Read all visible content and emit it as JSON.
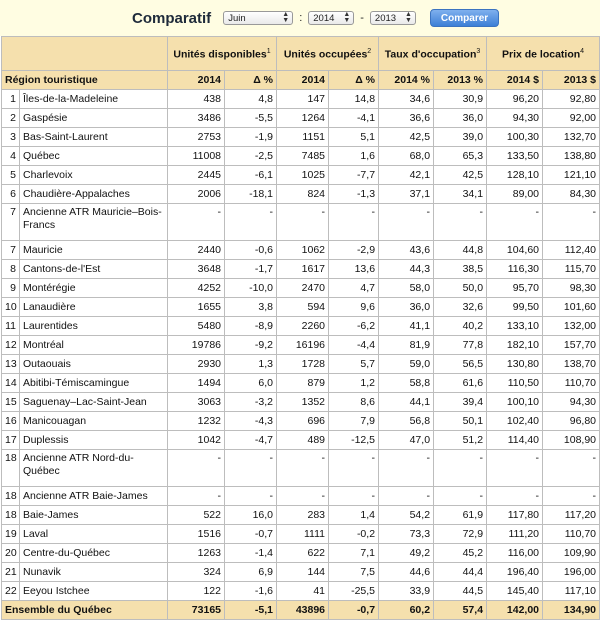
{
  "toolbar": {
    "title": "Comparatif",
    "month": "Juin",
    "year_from": "2014",
    "colon": ":",
    "dash": "-",
    "year_to": "2013",
    "compare_label": "Comparer"
  },
  "groups": [
    {
      "label": "Unités disponibles",
      "note": "1"
    },
    {
      "label": "Unités occupées",
      "note": "2"
    },
    {
      "label": "Taux d'occupation",
      "note": "3"
    },
    {
      "label": "Prix de location",
      "note": "4"
    }
  ],
  "subheaders": [
    "Région touristique",
    "2014",
    "Δ %",
    "2014",
    "Δ %",
    "2014 %",
    "2013 %",
    "2014 $",
    "2013 $"
  ],
  "rows": [
    {
      "n": "1",
      "region": "Îles-de-la-Madeleine",
      "u14": "438",
      "ud": "4,8",
      "o14": "147",
      "od": "14,8",
      "t14": "34,6",
      "t13": "30,9",
      "p14": "96,20",
      "p13": "92,80"
    },
    {
      "n": "2",
      "region": "Gaspésie",
      "u14": "3486",
      "ud": "-5,5",
      "o14": "1264",
      "od": "-4,1",
      "t14": "36,6",
      "t13": "36,0",
      "p14": "94,30",
      "p13": "92,00"
    },
    {
      "n": "3",
      "region": "Bas-Saint-Laurent",
      "u14": "2753",
      "ud": "-1,9",
      "o14": "1151",
      "od": "5,1",
      "t14": "42,5",
      "t13": "39,0",
      "p14": "100,30",
      "p13": "132,70"
    },
    {
      "n": "4",
      "region": "Québec",
      "u14": "11008",
      "ud": "-2,5",
      "o14": "7485",
      "od": "1,6",
      "t14": "68,0",
      "t13": "65,3",
      "p14": "133,50",
      "p13": "138,80"
    },
    {
      "n": "5",
      "region": "Charlevoix",
      "u14": "2445",
      "ud": "-6,1",
      "o14": "1025",
      "od": "-7,7",
      "t14": "42,1",
      "t13": "42,5",
      "p14": "128,10",
      "p13": "121,10"
    },
    {
      "n": "6",
      "region": "Chaudière-Appalaches",
      "u14": "2006",
      "ud": "-18,1",
      "o14": "824",
      "od": "-1,3",
      "t14": "37,1",
      "t13": "34,1",
      "p14": "89,00",
      "p13": "84,30"
    },
    {
      "n": "7",
      "region": "Ancienne ATR Mauricie–Bois-Francs",
      "u14": "-",
      "ud": "-",
      "o14": "-",
      "od": "-",
      "t14": "-",
      "t13": "-",
      "p14": "-",
      "p13": "-",
      "tall": true
    },
    {
      "n": "7",
      "region": "Mauricie",
      "u14": "2440",
      "ud": "-0,6",
      "o14": "1062",
      "od": "-2,9",
      "t14": "43,6",
      "t13": "44,8",
      "p14": "104,60",
      "p13": "112,40"
    },
    {
      "n": "8",
      "region": "Cantons-de-l'Est",
      "u14": "3648",
      "ud": "-1,7",
      "o14": "1617",
      "od": "13,6",
      "t14": "44,3",
      "t13": "38,5",
      "p14": "116,30",
      "p13": "115,70"
    },
    {
      "n": "9",
      "region": "Montérégie",
      "u14": "4252",
      "ud": "-10,0",
      "o14": "2470",
      "od": "4,7",
      "t14": "58,0",
      "t13": "50,0",
      "p14": "95,70",
      "p13": "98,30"
    },
    {
      "n": "10",
      "region": "Lanaudière",
      "u14": "1655",
      "ud": "3,8",
      "o14": "594",
      "od": "9,6",
      "t14": "36,0",
      "t13": "32,6",
      "p14": "99,50",
      "p13": "101,60"
    },
    {
      "n": "11",
      "region": "Laurentides",
      "u14": "5480",
      "ud": "-8,9",
      "o14": "2260",
      "od": "-6,2",
      "t14": "41,1",
      "t13": "40,2",
      "p14": "133,10",
      "p13": "132,00"
    },
    {
      "n": "12",
      "region": "Montréal",
      "u14": "19786",
      "ud": "-9,2",
      "o14": "16196",
      "od": "-4,4",
      "t14": "81,9",
      "t13": "77,8",
      "p14": "182,10",
      "p13": "157,70"
    },
    {
      "n": "13",
      "region": "Outaouais",
      "u14": "2930",
      "ud": "1,3",
      "o14": "1728",
      "od": "5,7",
      "t14": "59,0",
      "t13": "56,5",
      "p14": "130,80",
      "p13": "138,70"
    },
    {
      "n": "14",
      "region": "Abitibi-Témiscamingue",
      "u14": "1494",
      "ud": "6,0",
      "o14": "879",
      "od": "1,2",
      "t14": "58,8",
      "t13": "61,6",
      "p14": "110,50",
      "p13": "110,70"
    },
    {
      "n": "15",
      "region": "Saguenay–Lac-Saint-Jean",
      "u14": "3063",
      "ud": "-3,2",
      "o14": "1352",
      "od": "8,6",
      "t14": "44,1",
      "t13": "39,4",
      "p14": "100,10",
      "p13": "94,30"
    },
    {
      "n": "16",
      "region": "Manicouagan",
      "u14": "1232",
      "ud": "-4,3",
      "o14": "696",
      "od": "7,9",
      "t14": "56,8",
      "t13": "50,1",
      "p14": "102,40",
      "p13": "96,80"
    },
    {
      "n": "17",
      "region": "Duplessis",
      "u14": "1042",
      "ud": "-4,7",
      "o14": "489",
      "od": "-12,5",
      "t14": "47,0",
      "t13": "51,2",
      "p14": "114,40",
      "p13": "108,90"
    },
    {
      "n": "18",
      "region": "Ancienne ATR Nord-du-Québec",
      "u14": "-",
      "ud": "-",
      "o14": "-",
      "od": "-",
      "t14": "-",
      "t13": "-",
      "p14": "-",
      "p13": "-",
      "tall": true
    },
    {
      "n": "18",
      "region": "Ancienne ATR Baie-James",
      "u14": "-",
      "ud": "-",
      "o14": "-",
      "od": "-",
      "t14": "-",
      "t13": "-",
      "p14": "-",
      "p13": "-"
    },
    {
      "n": "18",
      "region": "Baie-James",
      "u14": "522",
      "ud": "16,0",
      "o14": "283",
      "od": "1,4",
      "t14": "54,2",
      "t13": "61,9",
      "p14": "117,80",
      "p13": "117,20"
    },
    {
      "n": "19",
      "region": "Laval",
      "u14": "1516",
      "ud": "-0,7",
      "o14": "1111",
      "od": "-0,2",
      "t14": "73,3",
      "t13": "72,9",
      "p14": "111,20",
      "p13": "110,70"
    },
    {
      "n": "20",
      "region": "Centre-du-Québec",
      "u14": "1263",
      "ud": "-1,4",
      "o14": "622",
      "od": "7,1",
      "t14": "49,2",
      "t13": "45,2",
      "p14": "116,00",
      "p13": "109,90"
    },
    {
      "n": "21",
      "region": "Nunavik",
      "u14": "324",
      "ud": "6,9",
      "o14": "144",
      "od": "7,5",
      "t14": "44,6",
      "t13": "44,4",
      "p14": "196,40",
      "p13": "196,00"
    },
    {
      "n": "22",
      "region": "Eeyou Istchee",
      "u14": "122",
      "ud": "-1,6",
      "o14": "41",
      "od": "-25,5",
      "t14": "33,9",
      "t13": "44,5",
      "p14": "145,40",
      "p13": "117,10"
    }
  ],
  "total": {
    "label": "Ensemble du Québec",
    "u14": "73165",
    "ud": "-5,1",
    "o14": "43896",
    "od": "-0,7",
    "t14": "60,2",
    "t13": "57,4",
    "p14": "142,00",
    "p13": "134,90"
  }
}
